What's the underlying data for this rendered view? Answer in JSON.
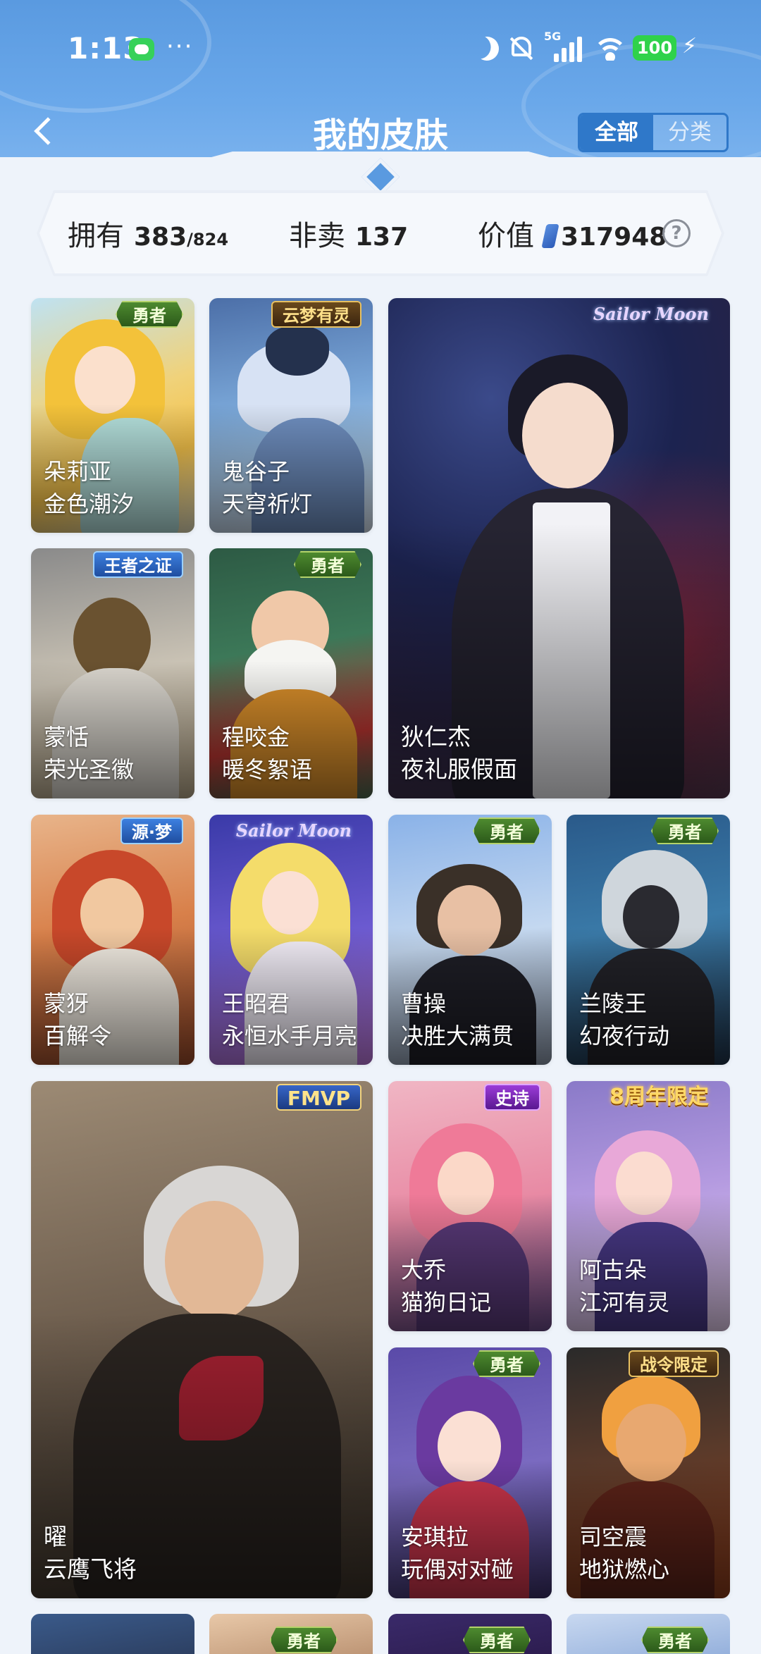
{
  "status_bar": {
    "time": "1:13",
    "more": "···",
    "network": "5G",
    "battery": "100",
    "icons": [
      "chat-app-icon",
      "moon-icon",
      "bell-off-icon",
      "signal-icon",
      "wifi-icon",
      "battery-icon",
      "charging-bolt-icon"
    ]
  },
  "header": {
    "title": "我的皮肤",
    "back_icon": "chevron-left-icon",
    "segments": [
      {
        "label": "全部",
        "active": true
      },
      {
        "label": "分类",
        "active": false
      }
    ]
  },
  "stats": {
    "owned_label": "拥有",
    "owned_count": "383",
    "owned_total": "/824",
    "not_for_sale_label": "非卖",
    "not_for_sale_count": "137",
    "value_label": "价值",
    "value_amount": "317948",
    "help_icon": "?"
  },
  "skins": [
    {
      "hero": "朵莉亚",
      "skin": "金色潮汐",
      "badge": "勇者"
    },
    {
      "hero": "鬼谷子",
      "skin": "天穹祈灯",
      "badge": "云梦有灵"
    },
    {
      "hero": "狄仁杰",
      "skin": "夜礼服假面",
      "badge": "Sailor Moon"
    },
    {
      "hero": "蒙恬",
      "skin": "荣光圣徽",
      "badge": "王者之证"
    },
    {
      "hero": "程咬金",
      "skin": "暖冬絮语",
      "badge": "勇者"
    },
    {
      "hero": "蒙犽",
      "skin": "百解令",
      "badge": "源·梦"
    },
    {
      "hero": "王昭君",
      "skin": "永恒水手月亮",
      "badge": "Sailor Moon"
    },
    {
      "hero": "曹操",
      "skin": "决胜大满贯",
      "badge": "勇者"
    },
    {
      "hero": "兰陵王",
      "skin": "幻夜行动",
      "badge": "勇者"
    },
    {
      "hero": "曜",
      "skin": "云鹰飞将",
      "badge": "FMVP"
    },
    {
      "hero": "大乔",
      "skin": "猫狗日记",
      "badge": "史诗"
    },
    {
      "hero": "阿古朵",
      "skin": "江河有灵",
      "badge": "8周年限定"
    },
    {
      "hero": "安琪拉",
      "skin": "玩偶对对碰",
      "badge": "勇者"
    },
    {
      "hero": "司空震",
      "skin": "地狱燃心",
      "badge": "战令限定"
    }
  ],
  "partial_badges": [
    "勇者",
    "勇者",
    "勇者"
  ],
  "colors": {
    "header_blue": "#5a9ae0",
    "segment_active": "#2f78c9",
    "page_bg": "#eef3fa"
  }
}
